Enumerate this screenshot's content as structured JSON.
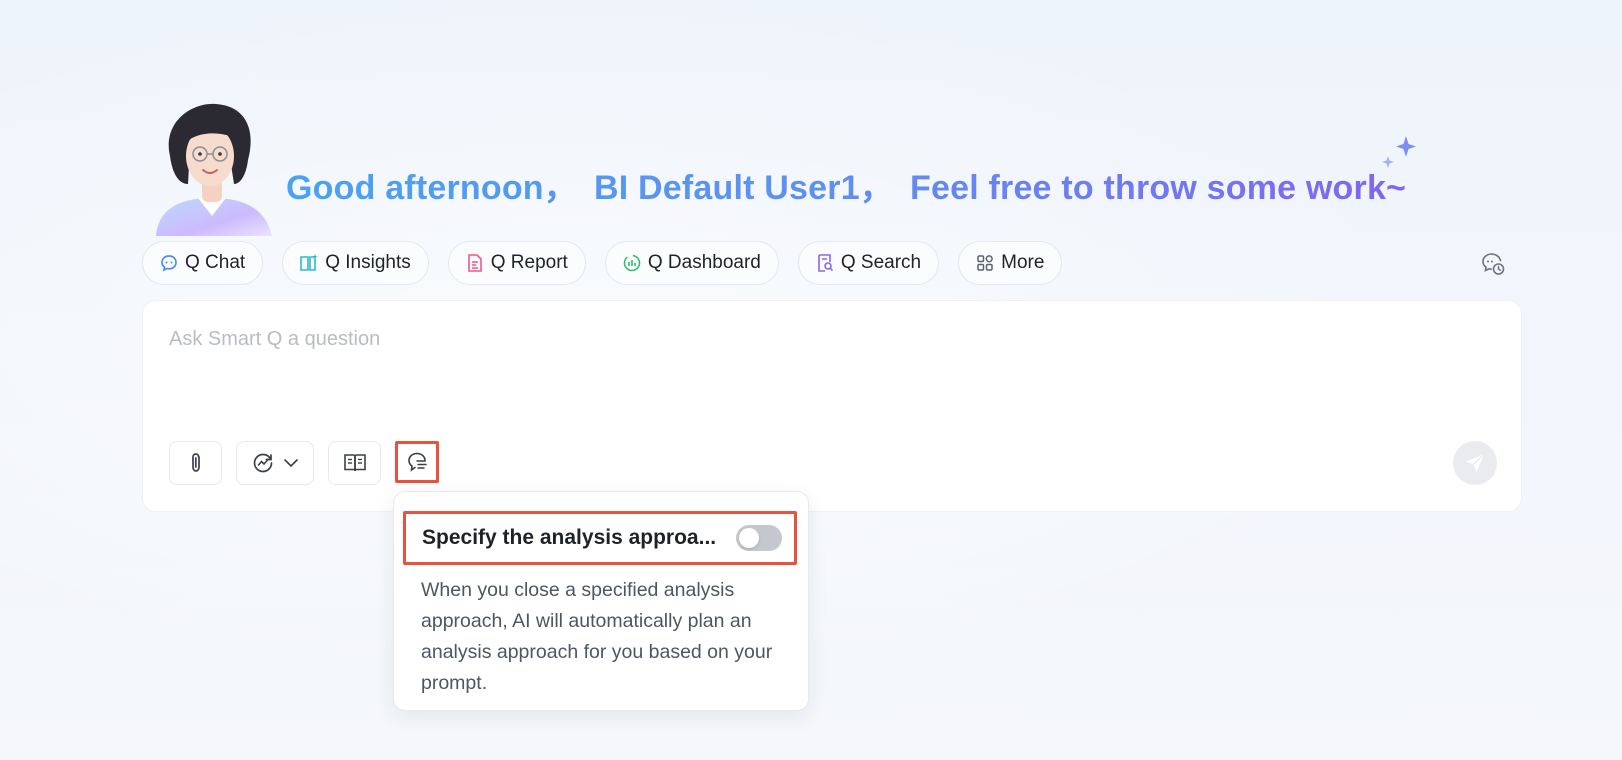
{
  "greeting": {
    "part1": "Good afternoon，",
    "part2": "BI Default User1，",
    "part3": "Feel free to throw some work~"
  },
  "tabs": [
    {
      "label": "Q Chat",
      "icon": "chat-bubble-icon",
      "color": "#4a8df6"
    },
    {
      "label": "Q Insights",
      "icon": "insights-book-icon",
      "color": "#2fb8c9"
    },
    {
      "label": "Q Report",
      "icon": "report-document-icon",
      "color": "#f0568c"
    },
    {
      "label": "Q Dashboard",
      "icon": "dashboard-chart-icon",
      "color": "#2fbf6f"
    },
    {
      "label": "Q Search",
      "icon": "search-document-icon",
      "color": "#8a67e6"
    },
    {
      "label": "More",
      "icon": "grid-apps-icon",
      "color": "#5b6270"
    }
  ],
  "input": {
    "placeholder": "Ask Smart Q a question"
  },
  "popover": {
    "title": "Specify the analysis approa...",
    "toggle_on": false,
    "description": "When you close a specified analysis approach, AI will automatically plan an analysis approach for you based on your prompt."
  },
  "colors": {
    "highlight": "#e8533f",
    "greeting_start": "#4aa2f2",
    "greeting_end": "#8265ef"
  }
}
